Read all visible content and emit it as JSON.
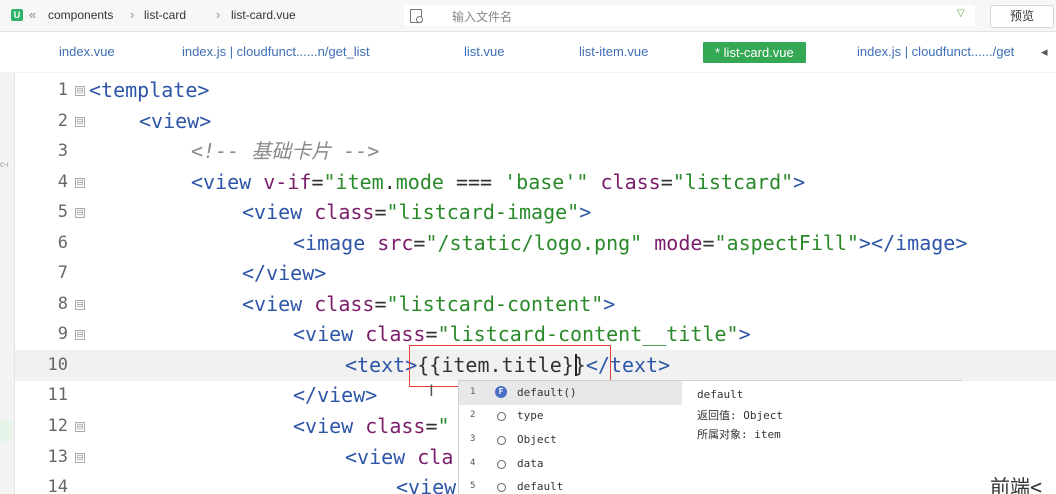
{
  "topbar": {
    "logo": "U",
    "back": "«",
    "breadcrumbs": [
      "components",
      "list-card",
      "list-card.vue"
    ],
    "file_search_placeholder": "输入文件名",
    "preview_label": "预览"
  },
  "tabs": [
    {
      "label": "index.vue",
      "active": false
    },
    {
      "label": "index.js | cloudfunct......n/get_list",
      "active": false
    },
    {
      "label": "list.vue",
      "active": false
    },
    {
      "label": "list-item.vue",
      "active": false
    },
    {
      "label": "* list-card.vue",
      "active": true
    },
    {
      "label": "index.js | cloudfunct....../get",
      "active": false
    }
  ],
  "tab_more": "◂",
  "left_mark": "c-ı",
  "editor": {
    "lines": [
      {
        "n": "1",
        "fold": "⊟"
      },
      {
        "n": "2",
        "fold": "⊟"
      },
      {
        "n": "3",
        "fold": ""
      },
      {
        "n": "4",
        "fold": "⊟"
      },
      {
        "n": "5",
        "fold": "⊟"
      },
      {
        "n": "6",
        "fold": ""
      },
      {
        "n": "7",
        "fold": ""
      },
      {
        "n": "8",
        "fold": "⊟"
      },
      {
        "n": "9",
        "fold": "⊟"
      },
      {
        "n": "10",
        "fold": ""
      },
      {
        "n": "11",
        "fold": ""
      },
      {
        "n": "12",
        "fold": "⊟"
      },
      {
        "n": "13",
        "fold": "⊟"
      },
      {
        "n": "14",
        "fold": ""
      }
    ],
    "code": {
      "l1_tag": "<template>",
      "l2_tag": "<view>",
      "l3_comment": "<!-- 基础卡片 -->",
      "l4_open": "<view",
      "l4_attr1": "v-if",
      "l4_eq1": "=",
      "l4_val1": "\"item",
      "l4_dot": ".",
      "l4_mode": "mode",
      "l4_op": " === ",
      "l4_base": "'base'",
      "l4_q": "\"",
      "l4_attr2": "class",
      "l4_eq2": "=",
      "l4_val2": "\"listcard\"",
      "l4_close": ">",
      "l5_open": "<view",
      "l5_attr": "class",
      "l5_eq": "=",
      "l5_val": "\"listcard-image\"",
      "l5_close": ">",
      "l6_open": "<image",
      "l6_attr1": "src",
      "l6_eq1": "=",
      "l6_val1": "\"/static/logo.png\"",
      "l6_attr2": "mode",
      "l6_eq2": "=",
      "l6_val2": "\"aspectFill\"",
      "l6_close": "></image>",
      "l7_tag": "</view>",
      "l8_open": "<view",
      "l8_attr": "class",
      "l8_eq": "=",
      "l8_val": "\"listcard-content\"",
      "l8_close": ">",
      "l9_open": "<view",
      "l9_attr": "class",
      "l9_eq": "=",
      "l9_val": "\"listcard-content__title\"",
      "l9_close": ">",
      "l10_open": "<text>",
      "l10_expr": "{{item.title}}",
      "l10_close": "</text>",
      "l11_tag": "</view>",
      "l12_open": "<view",
      "l12_attr": "class",
      "l12_eq": "=",
      "l12_val": "\"",
      "l13_open": "<view",
      "l13_attr": "cla",
      "l14_open": "<view",
      "l14_tail": "前端<"
    }
  },
  "autocomplete": {
    "items": [
      {
        "num": "1",
        "kind": "F",
        "label": "default()",
        "selected": true
      },
      {
        "num": "2",
        "kind": "o",
        "label": "type",
        "selected": false
      },
      {
        "num": "3",
        "kind": "o",
        "label": "Object",
        "selected": false
      },
      {
        "num": "4",
        "kind": "o",
        "label": "data",
        "selected": false
      },
      {
        "num": "5",
        "kind": "o",
        "label": "default",
        "selected": false
      }
    ],
    "detail": {
      "name": "default",
      "return_line": "返回值: Object",
      "owner_line": "所属对象: item"
    }
  }
}
